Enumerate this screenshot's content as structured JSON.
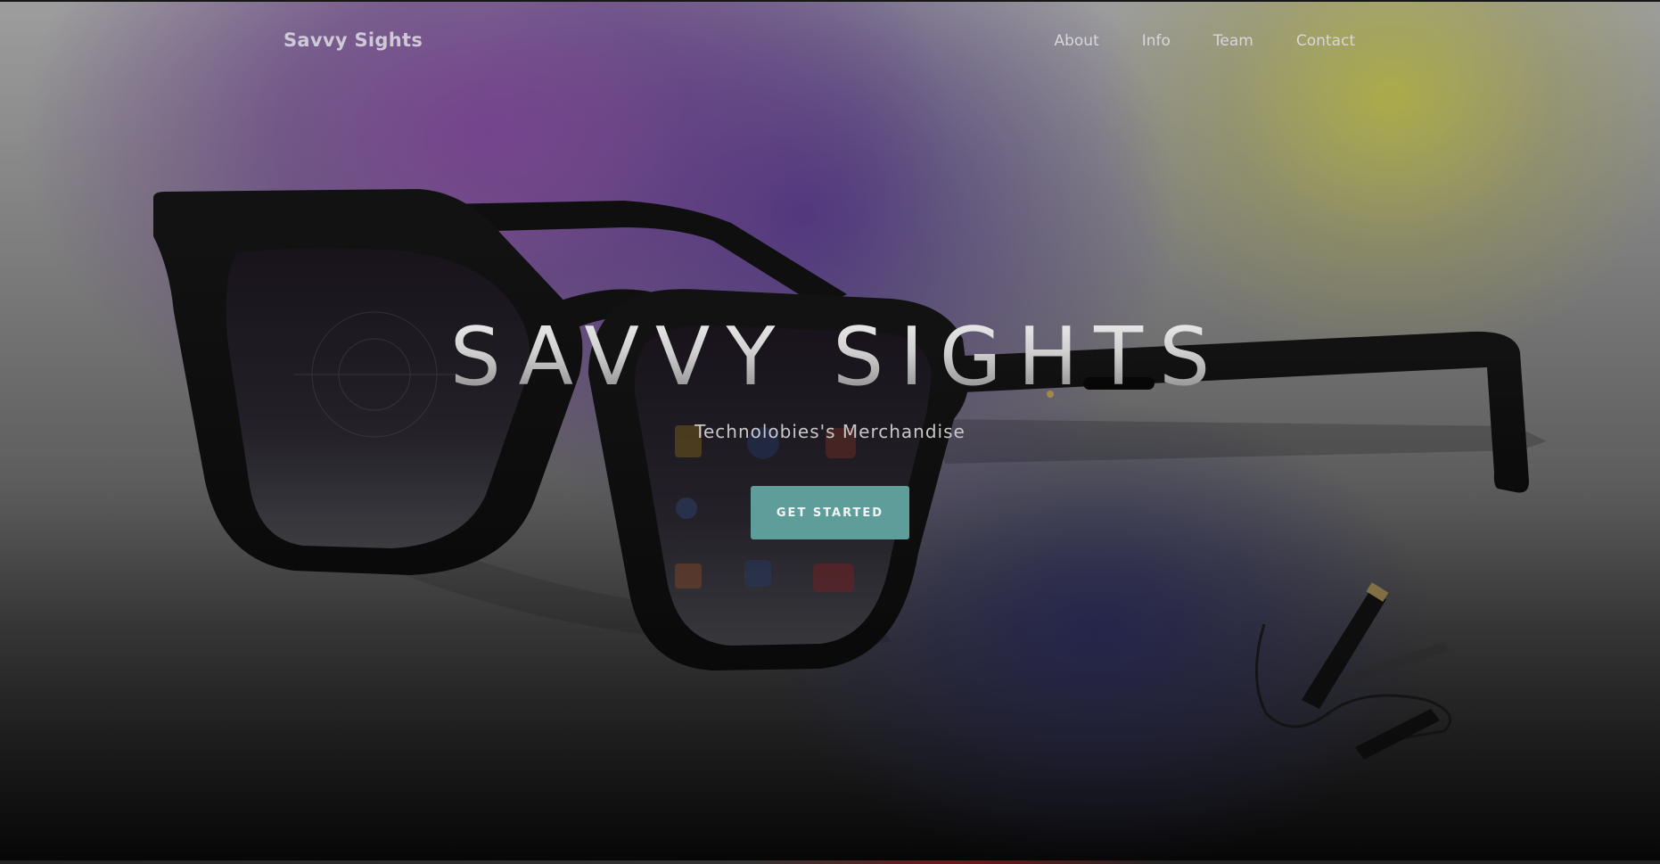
{
  "nav": {
    "brand": "Savvy Sights",
    "links": [
      {
        "label": "About"
      },
      {
        "label": "Info"
      },
      {
        "label": "Team"
      },
      {
        "label": "Contact"
      }
    ]
  },
  "hero": {
    "title": "SAVVY SIGHTS",
    "subtitle": "Technolobies's Merchandise",
    "cta_label": "GET STARTED"
  },
  "colors": {
    "accent": "#5f9d9b",
    "purple_glow": "#84489f",
    "yellow_glow": "#c8c846"
  }
}
